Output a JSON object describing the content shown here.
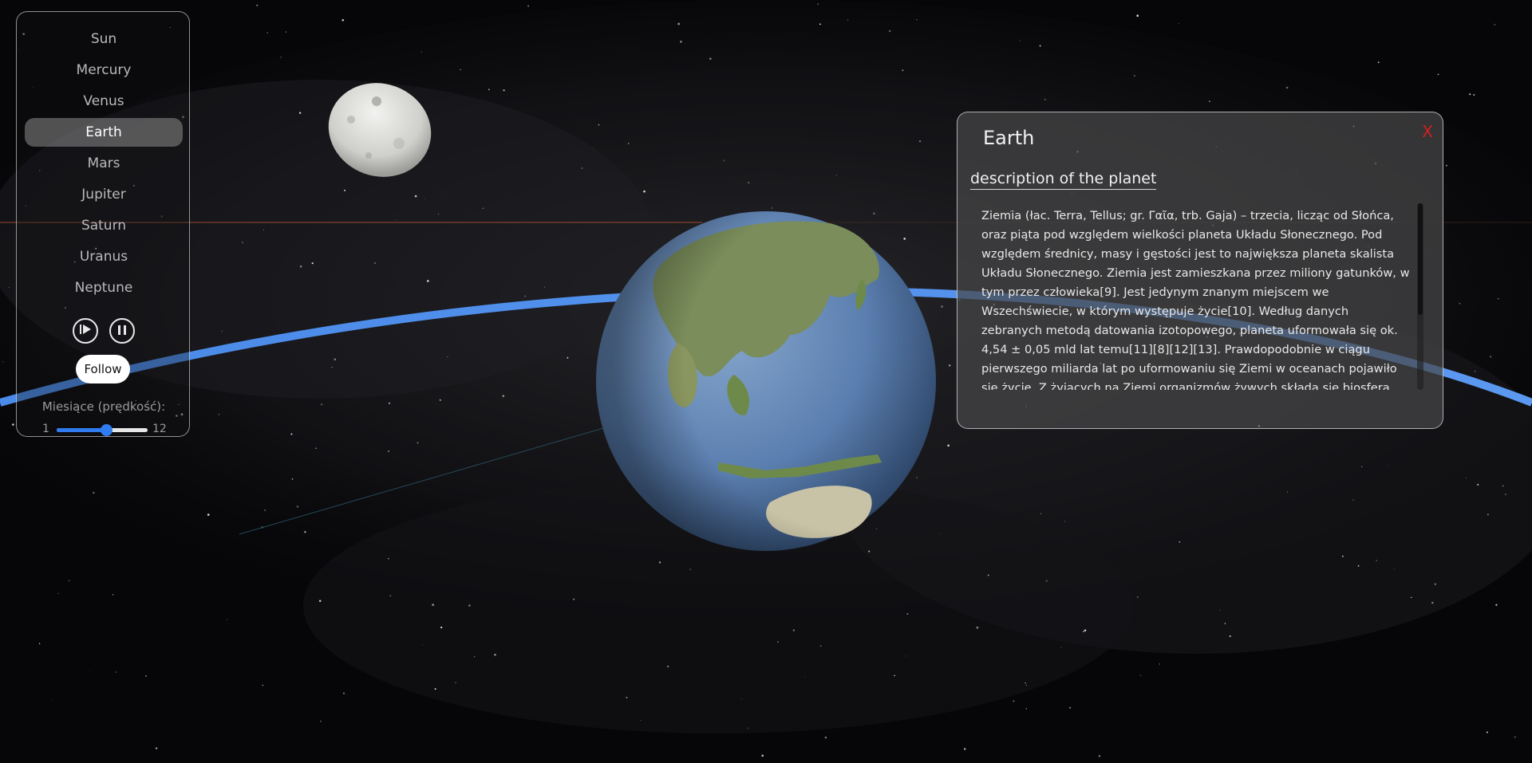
{
  "planets": [
    {
      "label": "Sun"
    },
    {
      "label": "Mercury"
    },
    {
      "label": "Venus"
    },
    {
      "label": "Earth"
    },
    {
      "label": "Mars"
    },
    {
      "label": "Jupiter"
    },
    {
      "label": "Saturn"
    },
    {
      "label": "Uranus"
    },
    {
      "label": "Neptune"
    }
  ],
  "selected_planet": "Earth",
  "controls": {
    "play_icon": "play-circle-icon",
    "pause_icon": "pause-circle-icon",
    "follow_label": "Follow"
  },
  "moons_slider": {
    "label": "Miesiące (prędkość):",
    "min_label": "1",
    "max_label": "12",
    "min": 1,
    "max": 12,
    "value": 7
  },
  "info": {
    "title": "Earth",
    "close_label": "X",
    "subtitle": "description of the planet",
    "body": "Ziemia (łac. Terra, Tellus; gr. Γαῖα, trb. Gaja) – trzecia, licząc od Słońca, oraz piąta pod względem wielkości planeta Układu Słonecznego. Pod względem średnicy, masy i gęstości jest to największa planeta skalista Układu Słonecznego. Ziemia jest zamieszkana przez miliony gatunków, w tym przez człowieka[9]. Jest jedynym znanym miejscem we Wszechświecie, w którym występuje życie[10]. Według danych zebranych metodą datowania izotopowego, planeta uformowała się ok. 4,54 ± 0,05 mld lat temu[11][8][12][13]. Prawdopodobnie w ciągu pierwszego miliarda lat po uformowaniu się Ziemi w oceanach pojawiło się życie. Z żyjących na Ziemi organizmów żywych składa się biosfera, która wpływa na jej atmosferę, hydrosferę",
    "scroll_position": 0
  },
  "colors": {
    "accent": "#2f7cf0",
    "orbit": "#4a8ae8",
    "close": "#d42020",
    "ocean": "#4e76a8",
    "land": "#6f8a4c"
  }
}
